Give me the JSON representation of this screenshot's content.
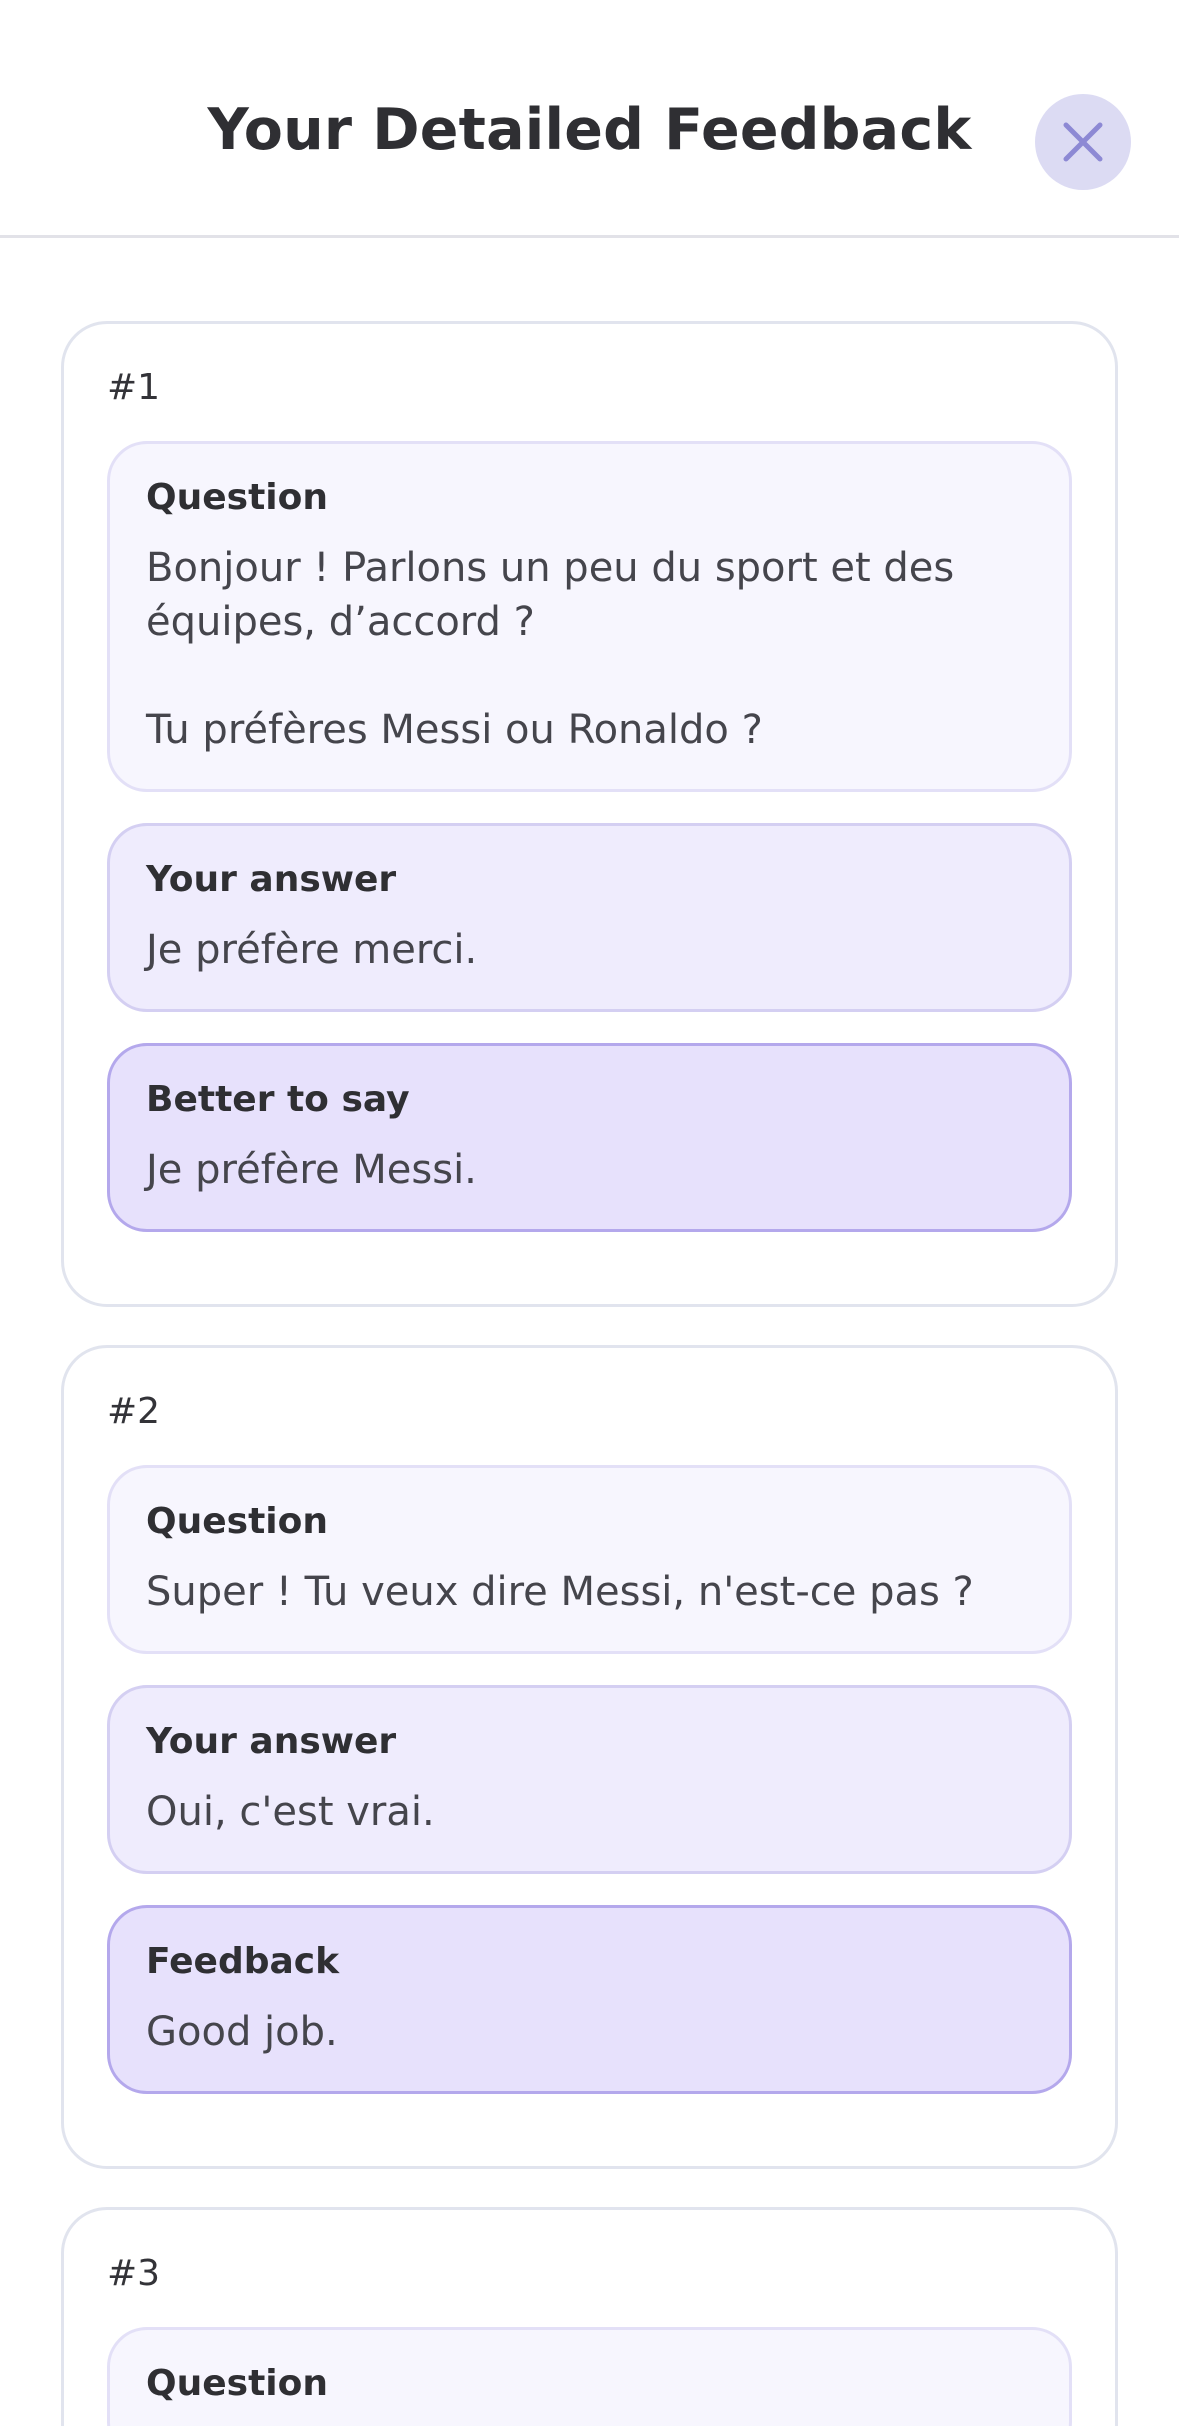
{
  "header": {
    "title": "Your Detailed Feedback",
    "close_icon": "close-icon"
  },
  "colors": {
    "question_bg": "#f7f6fe",
    "answer_bg": "#efecfd",
    "correction_bg": "#e7e1fc",
    "correction_border": "#b4a8ec",
    "close_bg": "#dcdbf3",
    "close_icon": "#8d89d4"
  },
  "cards": [
    {
      "number": "#1",
      "items": [
        {
          "label": "Question",
          "text": "Bonjour ! Parlons un peu du sport et des équipes, d’accord ?\n\nTu préfères Messi ou Ronaldo ?"
        },
        {
          "label": "Your answer",
          "text": "Je préfère merci."
        },
        {
          "label": "Better to say",
          "text": "Je préfère Messi."
        }
      ]
    },
    {
      "number": "#2",
      "items": [
        {
          "label": "Question",
          "text": "Super ! Tu veux dire Messi, n'est-ce pas ?"
        },
        {
          "label": "Your answer",
          "text": "Oui, c'est vrai."
        },
        {
          "label": "Feedback",
          "text": "Good job."
        }
      ]
    },
    {
      "number": "#3",
      "items": [
        {
          "label": "Question",
          "text": ""
        }
      ]
    }
  ]
}
